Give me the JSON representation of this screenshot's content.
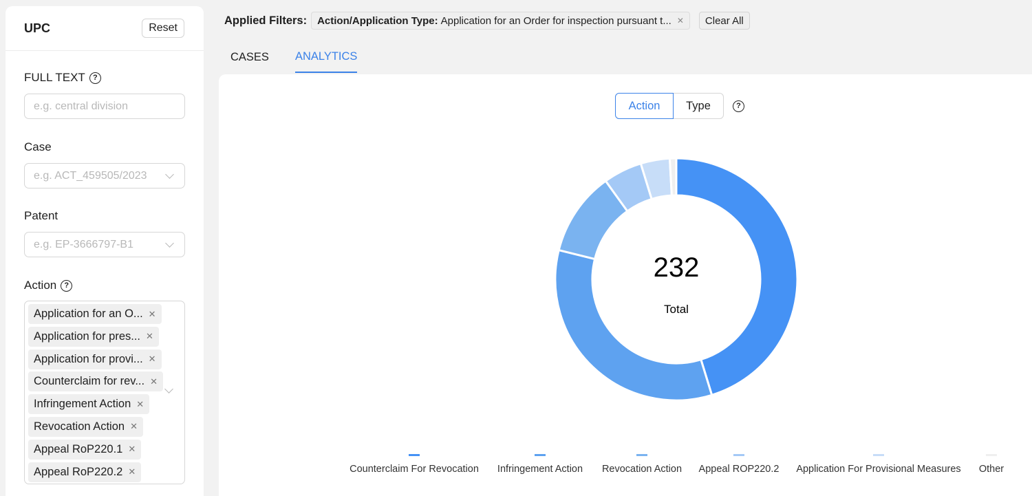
{
  "sidebar": {
    "title": "UPC",
    "reset_label": "Reset",
    "full_text": {
      "label": "FULL TEXT",
      "placeholder": "e.g. central division"
    },
    "case": {
      "label": "Case",
      "placeholder": "e.g. ACT_459505/2023"
    },
    "patent": {
      "label": "Patent",
      "placeholder": "e.g. EP-3666797-B1"
    },
    "action": {
      "label": "Action",
      "tags": [
        "Application for an O...",
        "Application for pres...",
        "Application for provi...",
        "Counterclaim for rev...",
        "Infringement Action",
        "Revocation Action",
        "Appeal RoP220.1",
        "Appeal RoP220.2"
      ]
    }
  },
  "filters": {
    "label": "Applied Filters:",
    "chip_key": "Action/Application Type:",
    "chip_value": "Application for an Order for inspection pursuant t...",
    "clear_label": "Clear All"
  },
  "tabs": [
    {
      "label": "CASES",
      "active": false
    },
    {
      "label": "ANALYTICS",
      "active": true
    }
  ],
  "analytics": {
    "toggle": {
      "options": [
        "Action",
        "Type"
      ],
      "selected": "Action"
    },
    "total_value": "232",
    "total_label": "Total"
  },
  "chart_data": {
    "type": "pie",
    "donut": true,
    "labels": [
      "Counterclaim For Revocation",
      "Infringement Action",
      "Revocation Action",
      "Appeal ROP220.2",
      "Application For Provisional Measures",
      "Other"
    ],
    "values": [
      105,
      78,
      26,
      12,
      9,
      2
    ],
    "colors": [
      "#4592f5",
      "#5ea2f0",
      "#7ab3f0",
      "#a4c9f6",
      "#c7ddf8",
      "#efefef"
    ],
    "legend_position": "bottom"
  },
  "icons": {
    "help": "help-circle-icon",
    "close": "close-icon",
    "chevron": "chevron-down-icon"
  }
}
